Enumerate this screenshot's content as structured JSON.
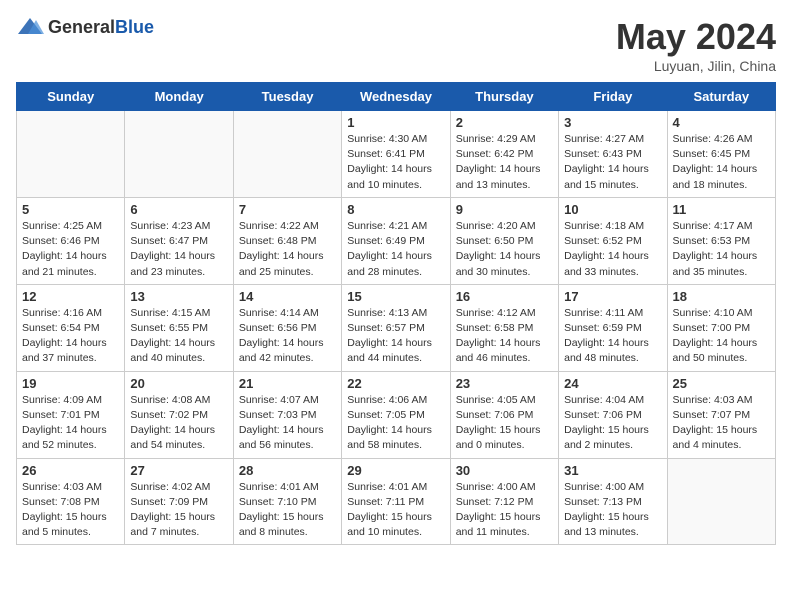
{
  "header": {
    "logo_general": "General",
    "logo_blue": "Blue",
    "month_title": "May 2024",
    "subtitle": "Luyuan, Jilin, China"
  },
  "days_of_week": [
    "Sunday",
    "Monday",
    "Tuesday",
    "Wednesday",
    "Thursday",
    "Friday",
    "Saturday"
  ],
  "weeks": [
    [
      {
        "day": "",
        "info": ""
      },
      {
        "day": "",
        "info": ""
      },
      {
        "day": "",
        "info": ""
      },
      {
        "day": "1",
        "info": "Sunrise: 4:30 AM\nSunset: 6:41 PM\nDaylight: 14 hours\nand 10 minutes."
      },
      {
        "day": "2",
        "info": "Sunrise: 4:29 AM\nSunset: 6:42 PM\nDaylight: 14 hours\nand 13 minutes."
      },
      {
        "day": "3",
        "info": "Sunrise: 4:27 AM\nSunset: 6:43 PM\nDaylight: 14 hours\nand 15 minutes."
      },
      {
        "day": "4",
        "info": "Sunrise: 4:26 AM\nSunset: 6:45 PM\nDaylight: 14 hours\nand 18 minutes."
      }
    ],
    [
      {
        "day": "5",
        "info": "Sunrise: 4:25 AM\nSunset: 6:46 PM\nDaylight: 14 hours\nand 21 minutes."
      },
      {
        "day": "6",
        "info": "Sunrise: 4:23 AM\nSunset: 6:47 PM\nDaylight: 14 hours\nand 23 minutes."
      },
      {
        "day": "7",
        "info": "Sunrise: 4:22 AM\nSunset: 6:48 PM\nDaylight: 14 hours\nand 25 minutes."
      },
      {
        "day": "8",
        "info": "Sunrise: 4:21 AM\nSunset: 6:49 PM\nDaylight: 14 hours\nand 28 minutes."
      },
      {
        "day": "9",
        "info": "Sunrise: 4:20 AM\nSunset: 6:50 PM\nDaylight: 14 hours\nand 30 minutes."
      },
      {
        "day": "10",
        "info": "Sunrise: 4:18 AM\nSunset: 6:52 PM\nDaylight: 14 hours\nand 33 minutes."
      },
      {
        "day": "11",
        "info": "Sunrise: 4:17 AM\nSunset: 6:53 PM\nDaylight: 14 hours\nand 35 minutes."
      }
    ],
    [
      {
        "day": "12",
        "info": "Sunrise: 4:16 AM\nSunset: 6:54 PM\nDaylight: 14 hours\nand 37 minutes."
      },
      {
        "day": "13",
        "info": "Sunrise: 4:15 AM\nSunset: 6:55 PM\nDaylight: 14 hours\nand 40 minutes."
      },
      {
        "day": "14",
        "info": "Sunrise: 4:14 AM\nSunset: 6:56 PM\nDaylight: 14 hours\nand 42 minutes."
      },
      {
        "day": "15",
        "info": "Sunrise: 4:13 AM\nSunset: 6:57 PM\nDaylight: 14 hours\nand 44 minutes."
      },
      {
        "day": "16",
        "info": "Sunrise: 4:12 AM\nSunset: 6:58 PM\nDaylight: 14 hours\nand 46 minutes."
      },
      {
        "day": "17",
        "info": "Sunrise: 4:11 AM\nSunset: 6:59 PM\nDaylight: 14 hours\nand 48 minutes."
      },
      {
        "day": "18",
        "info": "Sunrise: 4:10 AM\nSunset: 7:00 PM\nDaylight: 14 hours\nand 50 minutes."
      }
    ],
    [
      {
        "day": "19",
        "info": "Sunrise: 4:09 AM\nSunset: 7:01 PM\nDaylight: 14 hours\nand 52 minutes."
      },
      {
        "day": "20",
        "info": "Sunrise: 4:08 AM\nSunset: 7:02 PM\nDaylight: 14 hours\nand 54 minutes."
      },
      {
        "day": "21",
        "info": "Sunrise: 4:07 AM\nSunset: 7:03 PM\nDaylight: 14 hours\nand 56 minutes."
      },
      {
        "day": "22",
        "info": "Sunrise: 4:06 AM\nSunset: 7:05 PM\nDaylight: 14 hours\nand 58 minutes."
      },
      {
        "day": "23",
        "info": "Sunrise: 4:05 AM\nSunset: 7:06 PM\nDaylight: 15 hours\nand 0 minutes."
      },
      {
        "day": "24",
        "info": "Sunrise: 4:04 AM\nSunset: 7:06 PM\nDaylight: 15 hours\nand 2 minutes."
      },
      {
        "day": "25",
        "info": "Sunrise: 4:03 AM\nSunset: 7:07 PM\nDaylight: 15 hours\nand 4 minutes."
      }
    ],
    [
      {
        "day": "26",
        "info": "Sunrise: 4:03 AM\nSunset: 7:08 PM\nDaylight: 15 hours\nand 5 minutes."
      },
      {
        "day": "27",
        "info": "Sunrise: 4:02 AM\nSunset: 7:09 PM\nDaylight: 15 hours\nand 7 minutes."
      },
      {
        "day": "28",
        "info": "Sunrise: 4:01 AM\nSunset: 7:10 PM\nDaylight: 15 hours\nand 8 minutes."
      },
      {
        "day": "29",
        "info": "Sunrise: 4:01 AM\nSunset: 7:11 PM\nDaylight: 15 hours\nand 10 minutes."
      },
      {
        "day": "30",
        "info": "Sunrise: 4:00 AM\nSunset: 7:12 PM\nDaylight: 15 hours\nand 11 minutes."
      },
      {
        "day": "31",
        "info": "Sunrise: 4:00 AM\nSunset: 7:13 PM\nDaylight: 15 hours\nand 13 minutes."
      },
      {
        "day": "",
        "info": ""
      }
    ]
  ]
}
